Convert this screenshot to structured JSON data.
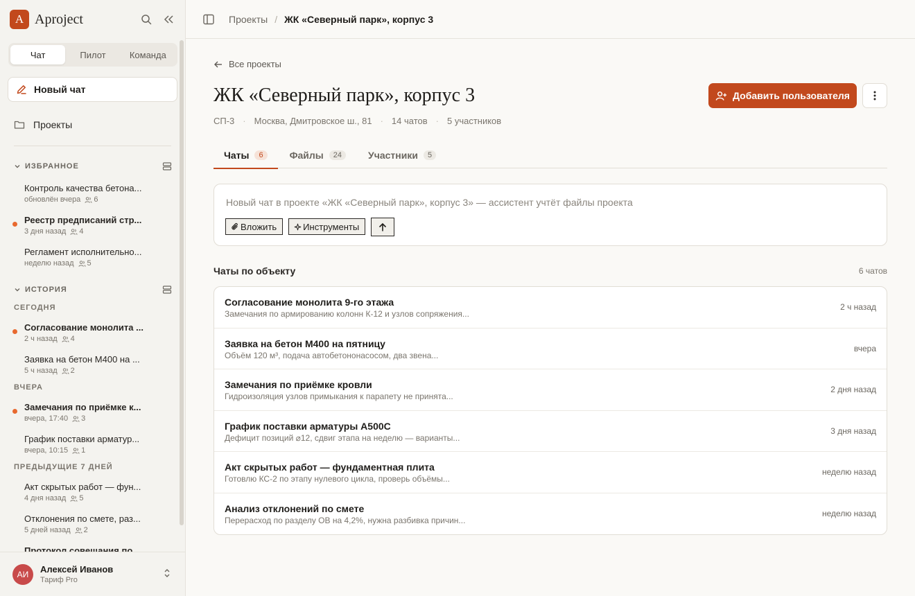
{
  "app": {
    "name": "Aproject",
    "logo_letter": "A",
    "accent": "#c2491d"
  },
  "sidebar": {
    "mode_tabs": [
      {
        "label": "Чат",
        "active": true
      },
      {
        "label": "Пилот",
        "active": false
      },
      {
        "label": "Команда",
        "active": false
      }
    ],
    "new_chat_label": "Новый чат",
    "projects_label": "Проекты",
    "favorites": {
      "title": "ИЗБРАННОЕ",
      "items": [
        {
          "title": "Контроль качества бетона...",
          "time": "обновлён вчера",
          "members": "6",
          "unread": false
        },
        {
          "title": "Реестр предписаний стр...",
          "time": "3 дня назад",
          "members": "4",
          "unread": true
        },
        {
          "title": "Регламент исполнительно...",
          "time": "неделю назад",
          "members": "5",
          "unread": false
        }
      ]
    },
    "history": {
      "title": "ИСТОРИЯ",
      "groups": [
        {
          "label": "СЕГОДНЯ"
        },
        {
          "label": "ВЧЕРА"
        },
        {
          "label": "ПРЕДЫДУЩИЕ 7 ДНЕЙ"
        }
      ],
      "items": [
        {
          "title": "Согласование монолита ...",
          "time": "2 ч назад",
          "members": "4",
          "unread": true
        },
        {
          "title": "Заявка на бетон М400 на ...",
          "time": "5 ч назад",
          "members": "2",
          "unread": false
        },
        {
          "title": "Замечания по приёмке к...",
          "time": "вчера, 17:40",
          "members": "3",
          "unread": true
        },
        {
          "title": "График поставки арматур...",
          "time": "вчера, 10:15",
          "members": "1",
          "unread": false
        },
        {
          "title": "Акт скрытых работ — фун...",
          "time": "4 дня назад",
          "members": "5",
          "unread": false
        },
        {
          "title": "Отклонения по смете, раз...",
          "time": "5 дней назад",
          "members": "2",
          "unread": false
        },
        {
          "title": "Протокол совещания по ...",
          "time": "",
          "members": "",
          "unread": true
        }
      ]
    },
    "user": {
      "initials": "АИ",
      "name": "Алексей Иванов",
      "plan": "Тариф Pro",
      "avatar_color": "#c84a4a"
    }
  },
  "topbar": {
    "breadcrumb_root": "Проекты",
    "breadcrumb_sep": "/",
    "breadcrumb_current": "ЖК «Северный парк», корпус 3"
  },
  "project": {
    "back_label": "Все проекты",
    "title": "ЖК «Северный парк», корпус 3",
    "code": "СП-3",
    "address": "Москва, Дмитровское ш., 81",
    "chats_count": "14 чатов",
    "members_count": "5 участников",
    "add_user_label": "Добавить пользователя"
  },
  "tabs": [
    {
      "label": "Чаты",
      "count": "6",
      "active": true
    },
    {
      "label": "Файлы",
      "count": "24",
      "active": false
    },
    {
      "label": "Участники",
      "count": "5",
      "active": false
    }
  ],
  "composer": {
    "placeholder": "Новый чат в проекте «ЖК «Северный парк», корпус 3» — ассистент учтёт файлы проекта",
    "attach_label": "Вложить",
    "tools_label": "Инструменты"
  },
  "chat_list": {
    "heading": "Чаты по объекту",
    "count_label": "6 чатов",
    "rows": [
      {
        "title": "Согласование монолита 9-го этажа",
        "snippet": "Замечания по армированию колонн К-12 и узлов сопряжения...",
        "when": "2 ч назад"
      },
      {
        "title": "Заявка на бетон М400 на пятницу",
        "snippet": "Объём 120 м³, подача автобетононасосом, два звена...",
        "when": "вчера"
      },
      {
        "title": "Замечания по приёмке кровли",
        "snippet": "Гидроизоляция узлов примыкания к парапету не принята...",
        "when": "2 дня назад"
      },
      {
        "title": "График поставки арматуры А500С",
        "snippet": "Дефицит позиций ⌀12, сдвиг этапа на неделю — варианты...",
        "when": "3 дня назад"
      },
      {
        "title": "Акт скрытых работ — фундаментная плита",
        "snippet": "Готовлю КС-2 по этапу нулевого цикла, проверь объёмы...",
        "when": "неделю назад"
      },
      {
        "title": "Анализ отклонений по смете",
        "snippet": "Перерасход по разделу ОВ на 4,2%, нужна разбивка причин...",
        "when": "неделю назад"
      }
    ]
  }
}
